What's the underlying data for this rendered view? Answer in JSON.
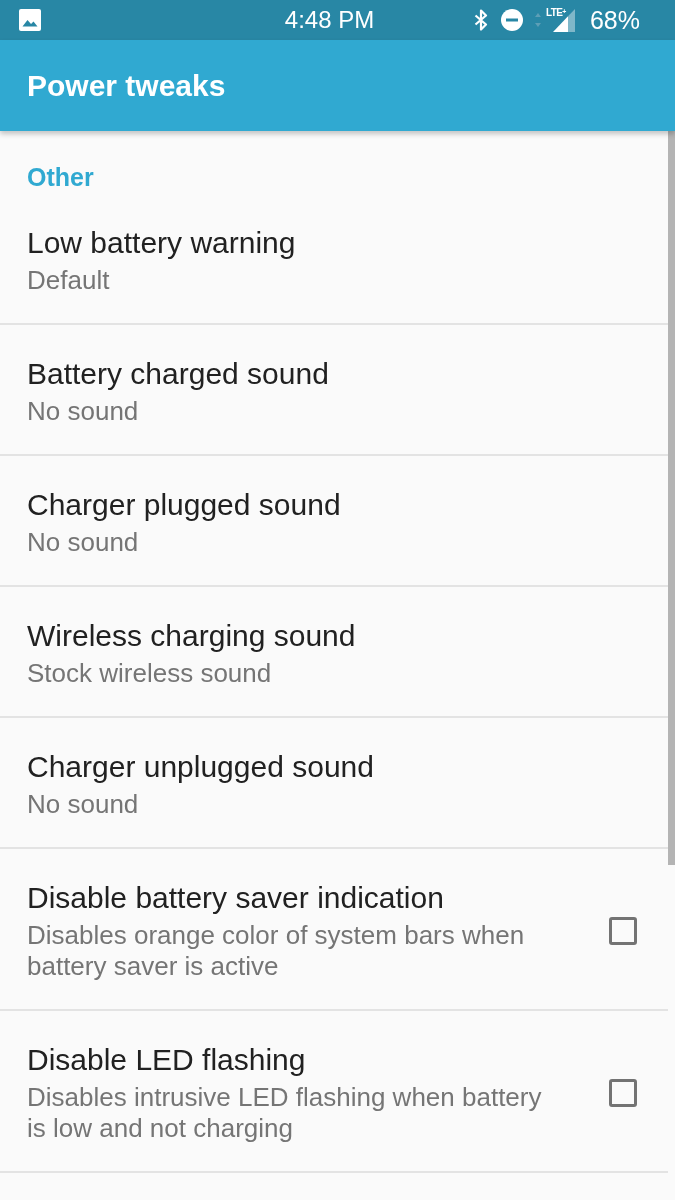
{
  "status_bar": {
    "time": "4:48 PM",
    "network_type": "LTE$^{+}$",
    "battery_percent": "68%"
  },
  "app_bar": {
    "title": "Power tweaks"
  },
  "sections": [
    {
      "header": "Other",
      "items": [
        {
          "kind": "value",
          "title": "Low battery warning",
          "summary": "Default"
        },
        {
          "kind": "value",
          "title": "Battery charged sound",
          "summary": "No sound"
        },
        {
          "kind": "value",
          "title": "Charger plugged sound",
          "summary": "No sound"
        },
        {
          "kind": "value",
          "title": "Wireless charging sound",
          "summary": "Stock wireless sound"
        },
        {
          "kind": "value",
          "title": "Charger unplugged sound",
          "summary": "No sound"
        },
        {
          "kind": "checkbox",
          "title": "Disable battery saver indication",
          "summary": "Disables orange color of system bars when battery saver is active",
          "checked": false
        },
        {
          "kind": "checkbox",
          "title": "Disable LED flashing",
          "summary": "Disables intrusive LED flashing when battery is low and not charging",
          "checked": false
        }
      ]
    }
  ]
}
